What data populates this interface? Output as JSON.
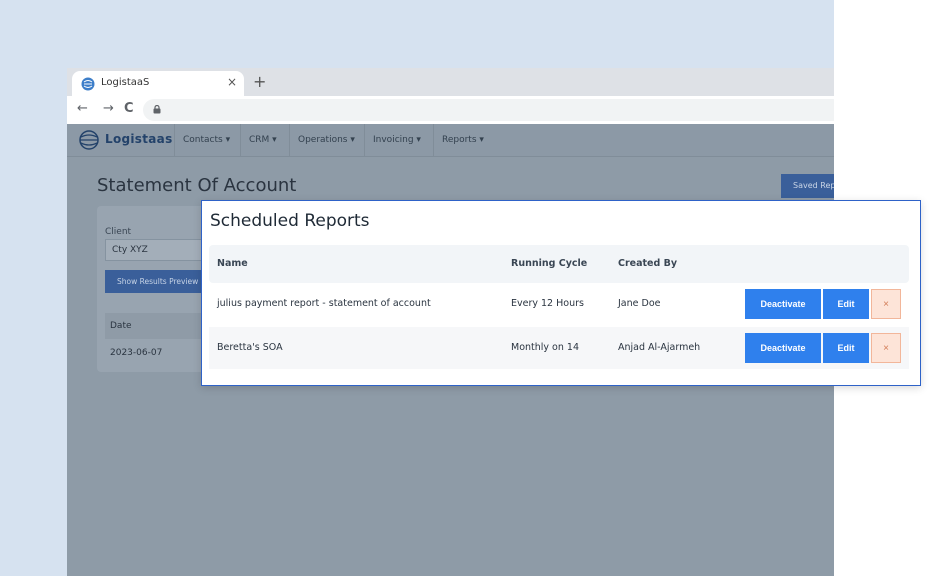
{
  "browser": {
    "tab_title": "LogistaaS",
    "tab_close": "×",
    "new_tab": "+",
    "back": "←",
    "forward": "→",
    "reload": "C"
  },
  "app": {
    "logo_text": "Logistaas",
    "nav": [
      {
        "label": "Contacts ▾"
      },
      {
        "label": "CRM ▾"
      },
      {
        "label": "Operations ▾"
      },
      {
        "label": "Invoicing ▾"
      },
      {
        "label": "Reports ▾"
      }
    ],
    "page_title": "Statement Of Account",
    "saved_reports_label": "Saved Repo",
    "client_label": "Client",
    "client_value": "Cty XYZ",
    "show_preview_label": "Show Results Preview",
    "date_header": "Date",
    "date_value": "2023-06-07"
  },
  "modal": {
    "title": "Scheduled Reports",
    "columns": [
      "Name",
      "Running Cycle",
      "Created By"
    ],
    "rows": [
      {
        "name": "julius payment report - statement of account",
        "cycle": "Every 12 Hours",
        "created_by": "Jane Doe"
      },
      {
        "name": "Beretta's SOA",
        "cycle": "Monthly on 14",
        "created_by": "Anjad Al-Ajarmeh"
      }
    ],
    "deactivate_label": "Deactivate",
    "edit_label": "Edit",
    "delete_label": "×"
  },
  "colors": {
    "primary": "#2f80ed",
    "modal_border": "#2e62c8",
    "overlay": "#8e9ba7",
    "delete_bg": "#fde4d8"
  }
}
